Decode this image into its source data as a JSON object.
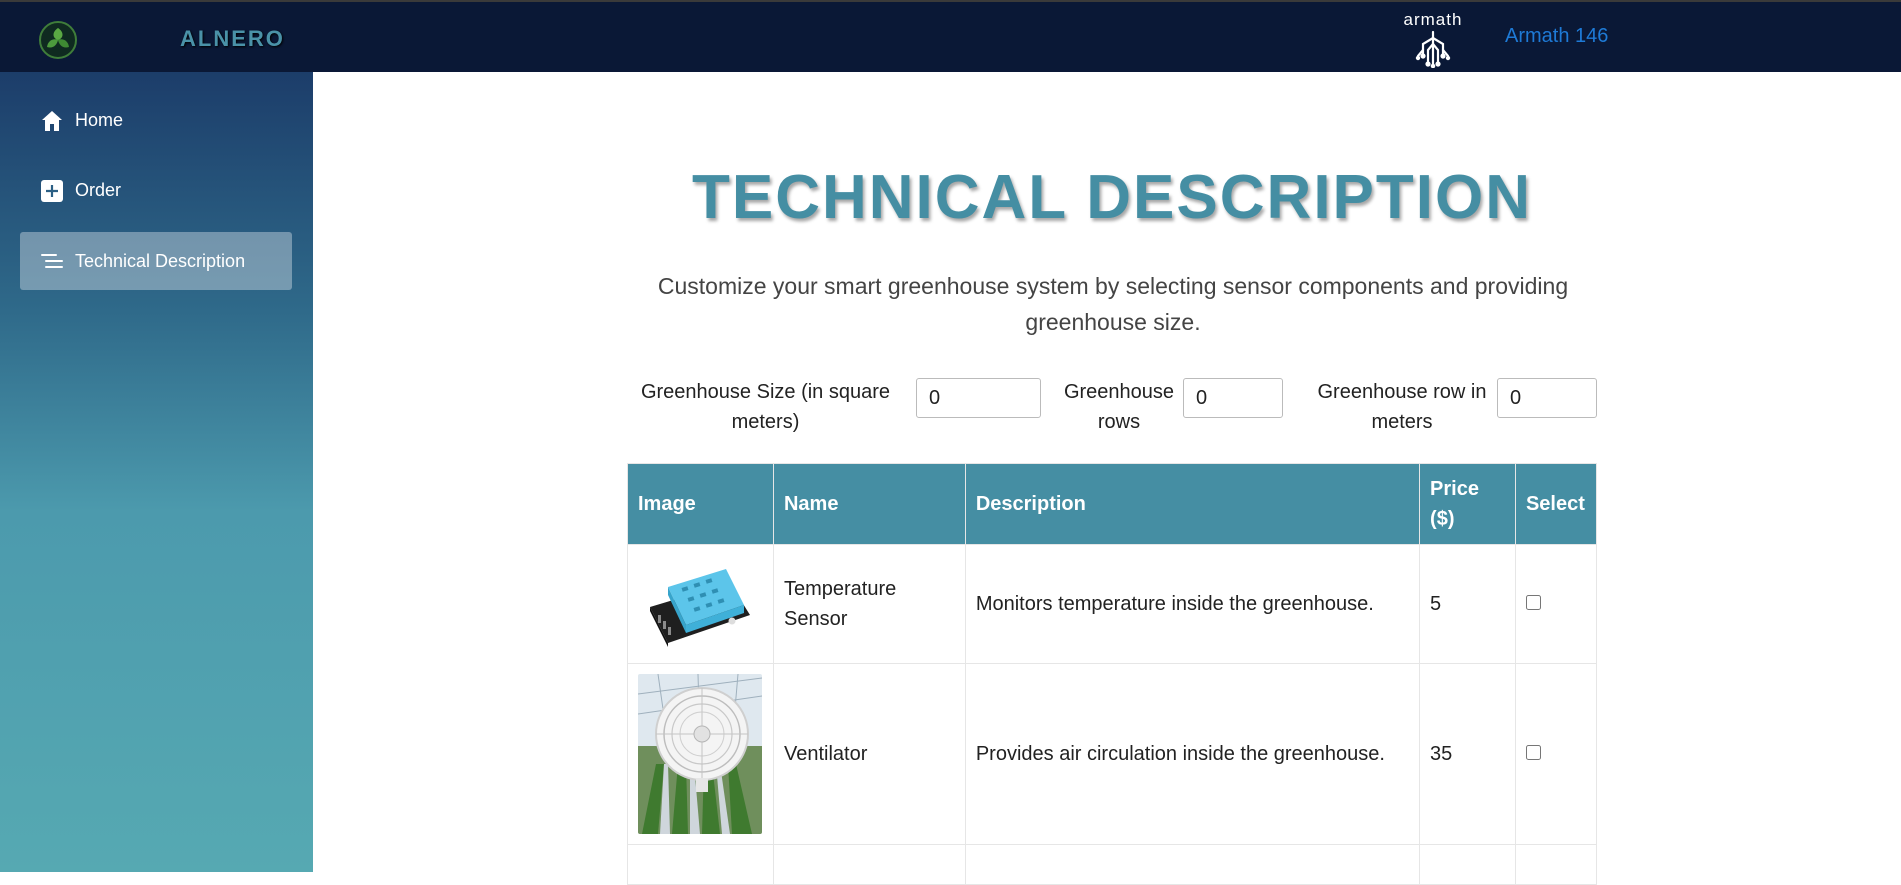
{
  "header": {
    "brand": "ALNERO",
    "partner_name": "armath",
    "user_label": "Armath 146"
  },
  "sidebar": {
    "items": [
      {
        "label": "Home",
        "icon": "home-icon"
      },
      {
        "label": "Order",
        "icon": "plus-square-icon"
      },
      {
        "label": "Technical Description",
        "icon": "list-lines-icon",
        "active": true
      }
    ]
  },
  "main": {
    "title": "TECHNICAL DESCRIPTION",
    "subtitle": "Customize your smart greenhouse system by selecting sensor components and providing greenhouse size.",
    "fields": {
      "size": {
        "label": "Greenhouse Size (in square meters)",
        "value": "0"
      },
      "rows": {
        "label": "Greenhouse rows",
        "value": "0"
      },
      "row_length": {
        "label": "Greenhouse row in meters",
        "value": "0"
      }
    },
    "table": {
      "headers": [
        "Image",
        "Name",
        "Description",
        "Price ($)",
        "Select"
      ],
      "rows": [
        {
          "name": "Temperature Sensor",
          "description": "Monitors temperature inside the greenhouse.",
          "price": "5",
          "image": "temperature-sensor-image",
          "selected": false
        },
        {
          "name": "Ventilator",
          "description": "Provides air circulation inside the greenhouse.",
          "price": "35",
          "image": "ventilator-image",
          "selected": false
        }
      ]
    }
  },
  "colors": {
    "topbar": "#0a1836",
    "accent": "#458ea3",
    "link": "#1e7ad6"
  }
}
